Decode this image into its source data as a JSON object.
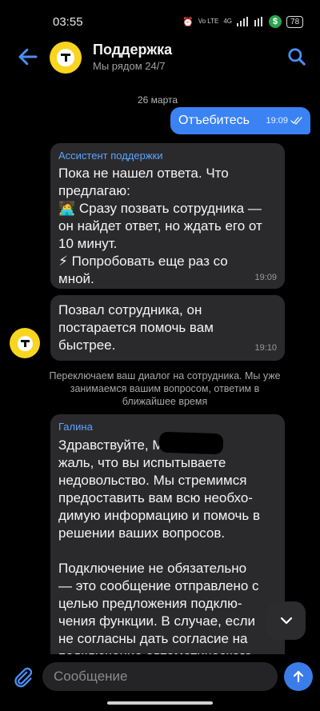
{
  "status_bar": {
    "time": "03:55",
    "network_text": "Vo LTE",
    "network_gen": "4G",
    "battery": "78"
  },
  "header": {
    "title": "Поддержка",
    "subtitle": "Мы рядом 24/7"
  },
  "date_separator": "26 марта",
  "outgoing": {
    "text": "Отъебитесь",
    "time": "19:09"
  },
  "assistant_message": {
    "sender": "Ассистент поддержки",
    "text": "Пока не нашел ответа. Что\nпредлагаю:\n🧑‍💻 Сразу позвать сотрудника —\nон найдет ответ, но ждать его от\n10 минут.\n⚡ Попробовать еще раз со\nмной.",
    "time": "19:09"
  },
  "called_message": {
    "text": "Позвал сотрудника, он\nпостарается помочь вам\nбыстрее.",
    "time": "19:10"
  },
  "system_message": "Переключаем ваш диалог на сотрудника. Мы уже занимаемся вашим вопросом, ответим в ближайшее время",
  "agent_message": {
    "sender": "Галина",
    "text": "Здравствуйте,             Мне\nжаль, что вы испытываете\nнедовольство. Мы стремимся\nпредоставить вам всю необхо-\nдимую информацию и помочь в\nрешении ваших вопросов.\n\nПодключение не обязательно\n— это сообщение отправлено с\nцелью предложения подклю-\nчения функции. В случае, если\nне согласны дать согласие на\nподключение автоматического"
  },
  "composer": {
    "placeholder": "Сообщение"
  },
  "colors": {
    "accent": "#3b83f4",
    "brand_yellow": "#f7d520",
    "bubble_bg": "#2a2a2c"
  }
}
